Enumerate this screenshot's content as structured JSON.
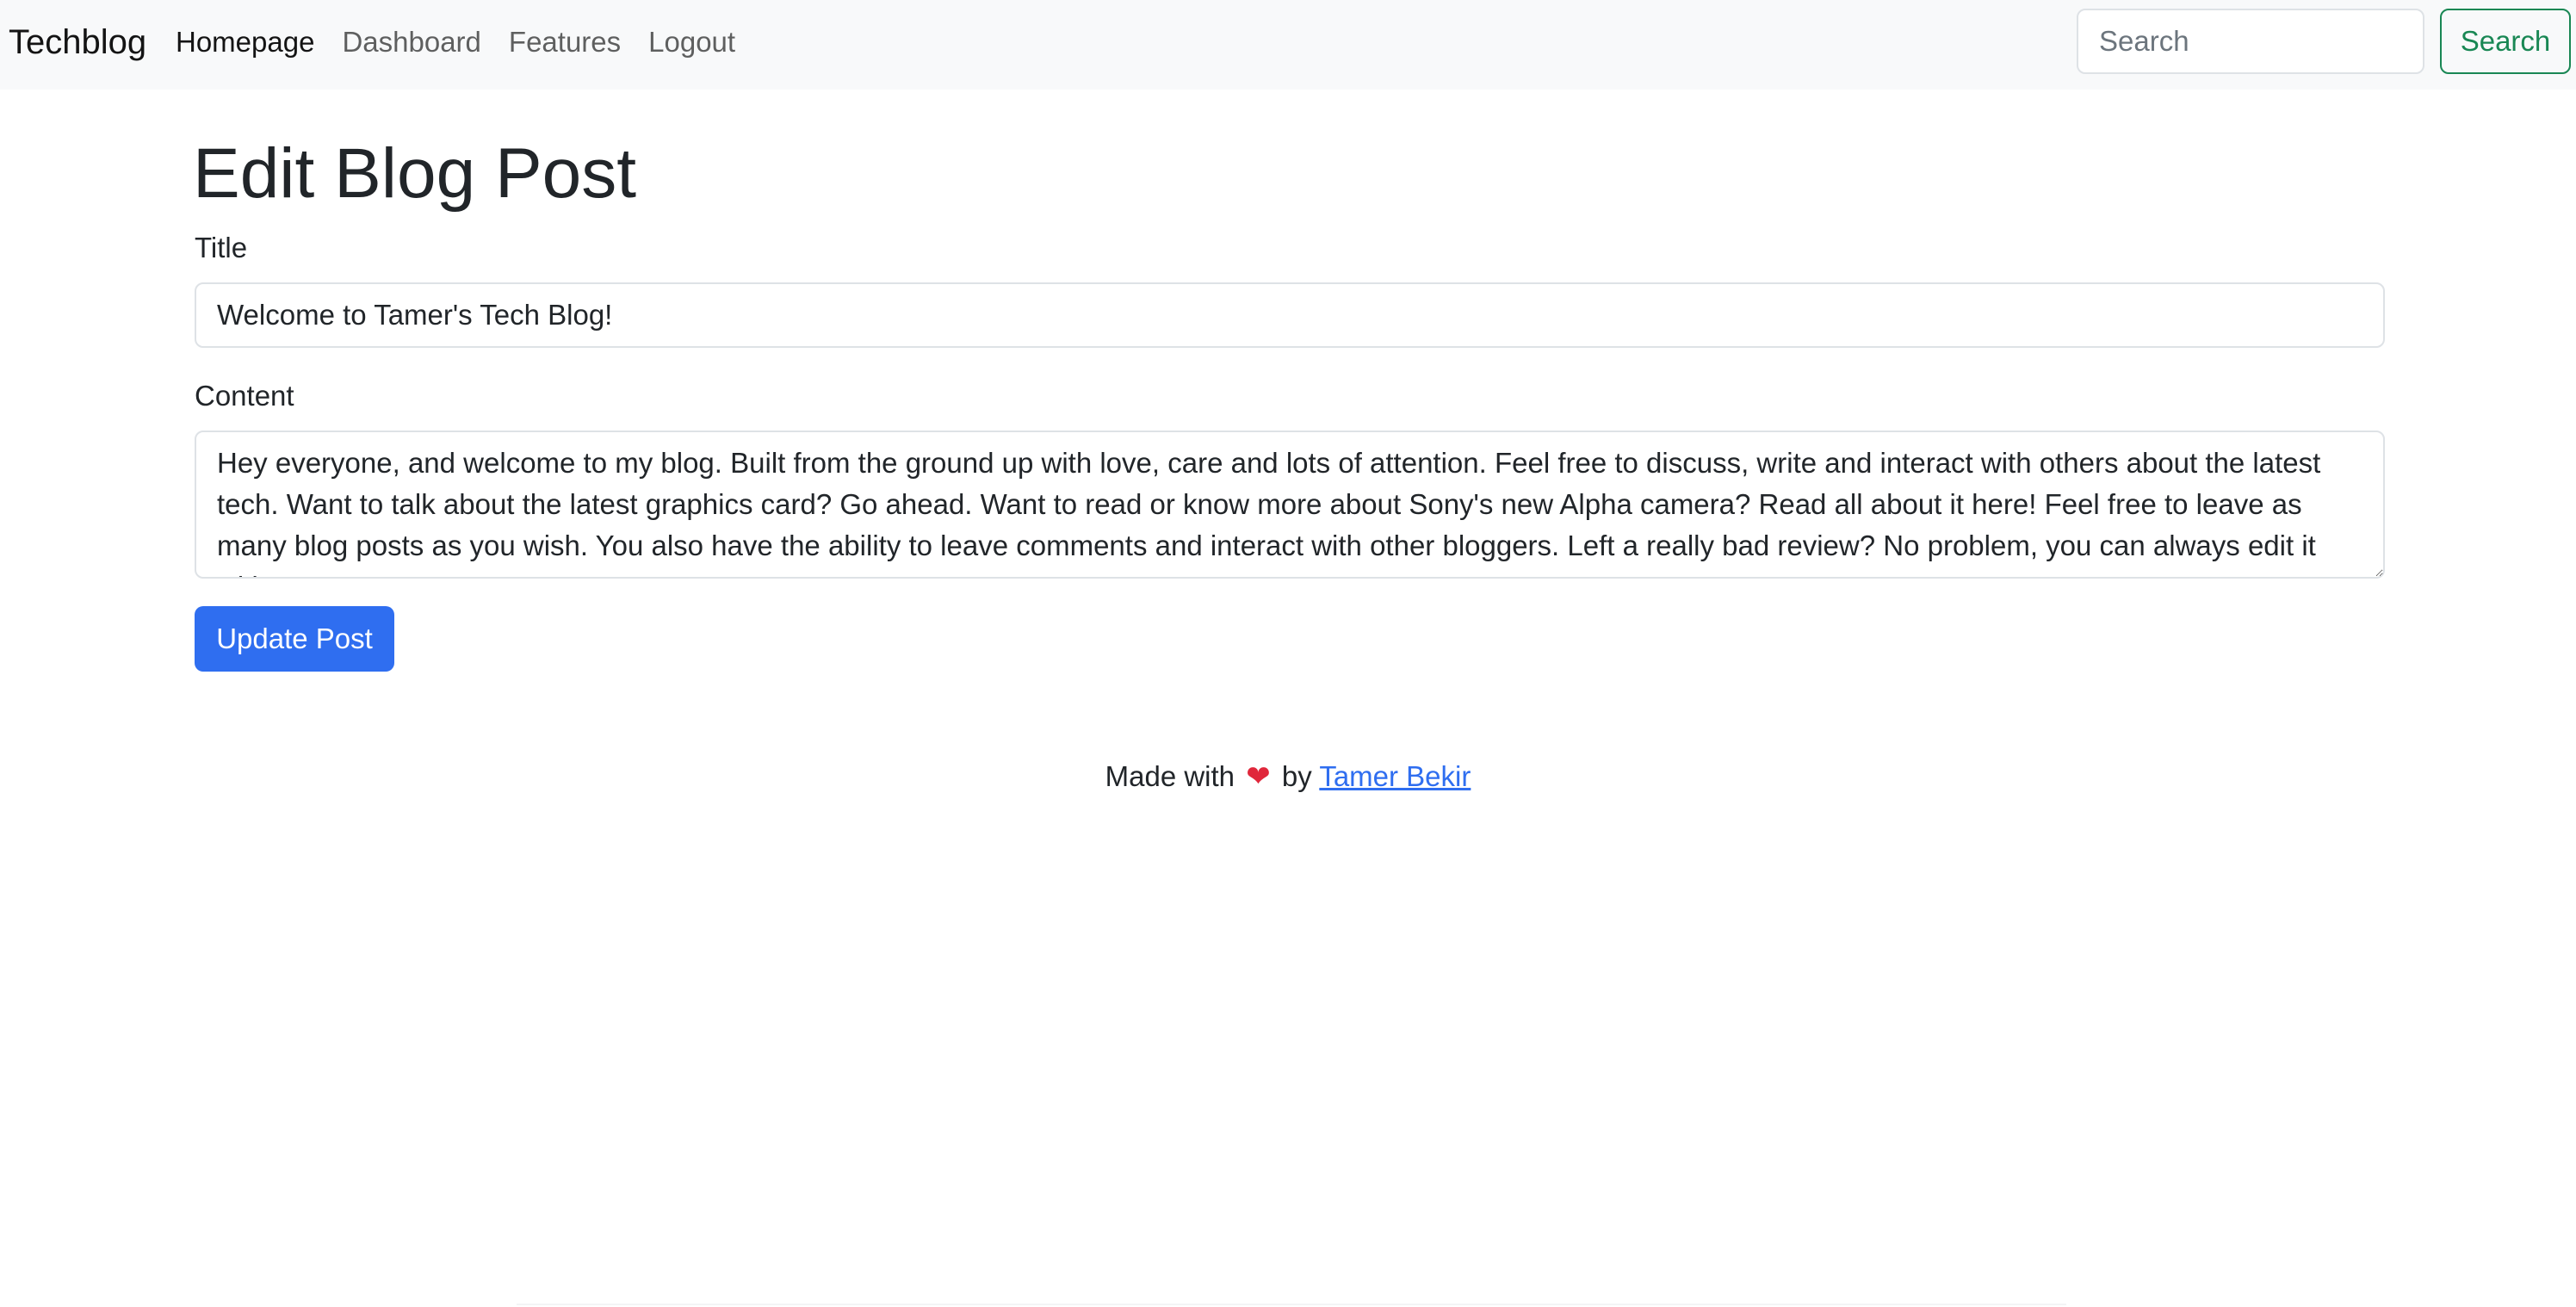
{
  "navbar": {
    "brand": "Techblog",
    "links": [
      {
        "label": "Homepage",
        "active": true
      },
      {
        "label": "Dashboard",
        "active": false
      },
      {
        "label": "Features",
        "active": false
      },
      {
        "label": "Logout",
        "active": false
      }
    ],
    "search": {
      "placeholder": "Search",
      "value": "",
      "button_label": "Search"
    }
  },
  "main": {
    "heading": "Edit Blog Post",
    "title_label": "Title",
    "title_value": "Welcome to Tamer's Tech Blog!",
    "content_label": "Content",
    "content_value": "Hey everyone, and welcome to my blog. Built from the ground up with love, care and lots of attention. Feel free to discuss, write and interact with others about the latest tech. Want to talk about the latest graphics card? Go ahead. Want to read or know more about Sony's new Alpha camera? Read all about it here! Feel free to leave as many blog posts as you wish. You also have the ability to leave comments and interact with other bloggers. Left a really bad review? No problem, you can always edit it without",
    "submit_label": "Update Post"
  },
  "footer": {
    "prefix": "Made with",
    "heart_glyph": "❤",
    "middle": "by",
    "author_link": "Tamer Bekir"
  },
  "colors": {
    "primary": "#2f6ef0",
    "success": "#198754",
    "navbar_bg": "#f8f9fa",
    "heart": "#e0273b"
  }
}
